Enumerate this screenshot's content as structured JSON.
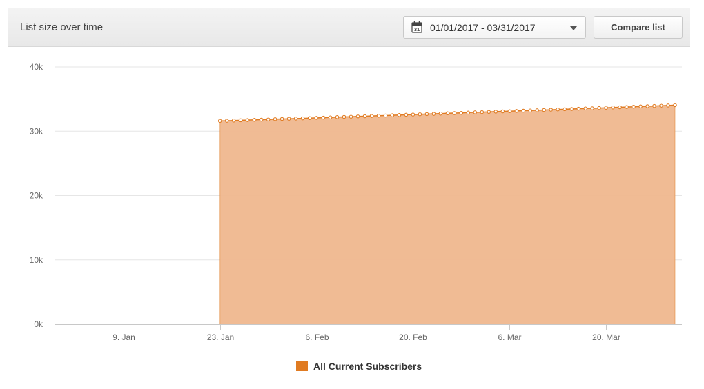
{
  "header": {
    "title": "List size over time",
    "date_range": "01/01/2017 - 03/31/2017",
    "calendar_day": "31",
    "compare_label": "Compare list"
  },
  "colors": {
    "series_line": "#e07b22",
    "series_fill": "#efb78e",
    "grid": "#e6e6e6",
    "axis_text": "#666666"
  },
  "chart_data": {
    "type": "area",
    "title": "",
    "xlabel": "",
    "ylabel": "",
    "ylim": [
      0,
      40000
    ],
    "yticks": [
      0,
      10000,
      20000,
      30000,
      40000
    ],
    "ytick_labels": [
      "0k",
      "10k",
      "20k",
      "30k",
      "40k"
    ],
    "xlim": [
      "2016-12-30",
      "2017-03-31"
    ],
    "xticks": [
      "2017-01-09",
      "2017-01-23",
      "2017-02-06",
      "2017-02-20",
      "2017-03-06",
      "2017-03-20"
    ],
    "xtick_labels": [
      "9. Jan",
      "23. Jan",
      "6. Feb",
      "20. Feb",
      "6. Mar",
      "20. Mar"
    ],
    "grid": true,
    "legend_position": "bottom-center",
    "series": [
      {
        "name": "All Current Subscribers",
        "x_start": "2017-01-23",
        "x_end": "2017-03-30",
        "values": [
          31600,
          31630,
          31660,
          31700,
          31730,
          31760,
          31800,
          31830,
          31870,
          31900,
          31940,
          31970,
          32000,
          32040,
          32080,
          32110,
          32150,
          32190,
          32220,
          32260,
          32300,
          32330,
          32370,
          32410,
          32440,
          32480,
          32520,
          32560,
          32590,
          32630,
          32670,
          32700,
          32740,
          32780,
          32810,
          32850,
          32890,
          32930,
          32960,
          33000,
          33040,
          33080,
          33110,
          33150,
          33190,
          33220,
          33260,
          33300,
          33340,
          33380,
          33420,
          33460,
          33500,
          33540,
          33570,
          33610,
          33650,
          33690,
          33730,
          33770,
          33810,
          33850,
          33890,
          33930,
          33970,
          34010,
          34060
        ]
      }
    ]
  }
}
